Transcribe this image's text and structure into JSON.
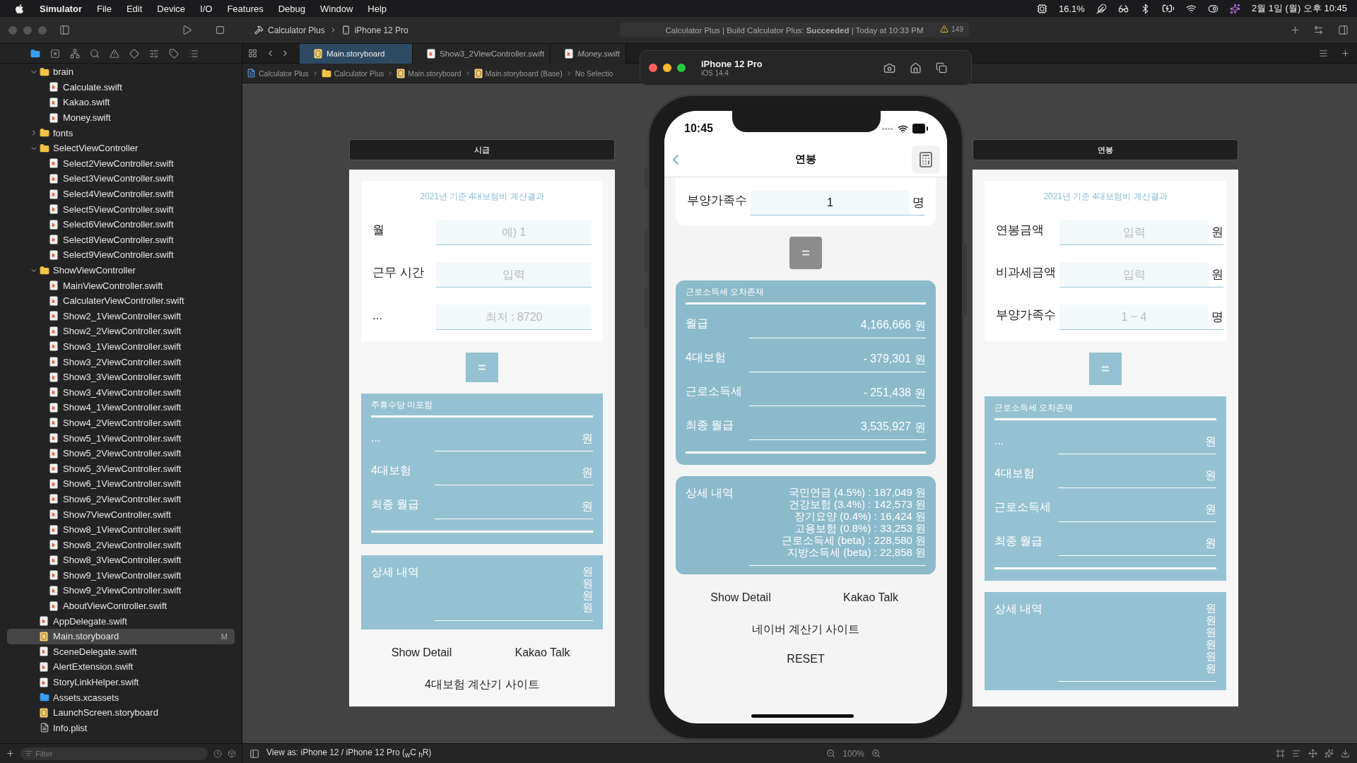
{
  "menu_bar": {
    "app": "Simulator",
    "menus": [
      "File",
      "Edit",
      "Device",
      "I/O",
      "Features",
      "Debug",
      "Window",
      "Help"
    ],
    "cpu": "16.1%",
    "clock": "2월 1일 (월) 오후 10:45"
  },
  "toolbar": {
    "scheme": "Calculator Plus",
    "destination": "iPhone 12 Pro",
    "activity": "Calculator Plus | Build Calculator Plus: **Succeeded** | Today at 10:33 PM",
    "warnings": "149"
  },
  "navigator": {
    "tree": [
      {
        "name": "brain",
        "kind": "folder",
        "expanded": true,
        "selected": false,
        "children": [
          {
            "name": "Calculate.swift",
            "kind": "swift",
            "selected": false
          },
          {
            "name": "Kakao.swift",
            "kind": "swift",
            "selected": false
          },
          {
            "name": "Money.swift",
            "kind": "swift",
            "selected": false
          }
        ]
      },
      {
        "name": "fonts",
        "kind": "folder",
        "expanded": false,
        "selected": false
      },
      {
        "name": "SelectViewController",
        "kind": "folder",
        "expanded": true,
        "selected": false,
        "children": [
          {
            "name": "Select2ViewController.swift",
            "kind": "swift",
            "selected": false
          },
          {
            "name": "Select3ViewController.swift",
            "kind": "swift",
            "selected": false
          },
          {
            "name": "Select4ViewController.swift",
            "kind": "swift",
            "selected": false
          },
          {
            "name": "Select5ViewController.swift",
            "kind": "swift",
            "selected": false
          },
          {
            "name": "Select6ViewController.swift",
            "kind": "swift",
            "selected": false
          },
          {
            "name": "Select8ViewController.swift",
            "kind": "swift",
            "selected": false
          },
          {
            "name": "Select9ViewController.swift",
            "kind": "swift",
            "selected": false
          }
        ]
      },
      {
        "name": "ShowViewController",
        "kind": "folder",
        "expanded": true,
        "selected": false,
        "children": [
          {
            "name": "MainViewController.swift",
            "kind": "swift",
            "selected": false
          },
          {
            "name": "CalculaterViewController.swift",
            "kind": "swift",
            "selected": false
          },
          {
            "name": "Show2_1ViewController.swift",
            "kind": "swift",
            "selected": false
          },
          {
            "name": "Show2_2ViewController.swift",
            "kind": "swift",
            "selected": false
          },
          {
            "name": "Show3_1ViewController.swift",
            "kind": "swift",
            "selected": false
          },
          {
            "name": "Show3_2ViewController.swift",
            "kind": "swift",
            "selected": false
          },
          {
            "name": "Show3_3ViewController.swift",
            "kind": "swift",
            "selected": false
          },
          {
            "name": "Show3_4ViewController.swift",
            "kind": "swift",
            "selected": false
          },
          {
            "name": "Show4_1ViewController.swift",
            "kind": "swift",
            "selected": false
          },
          {
            "name": "Show4_2ViewController.swift",
            "kind": "swift",
            "selected": false
          },
          {
            "name": "Show5_1ViewController.swift",
            "kind": "swift",
            "selected": false
          },
          {
            "name": "Show5_2ViewController.swift",
            "kind": "swift",
            "selected": false
          },
          {
            "name": "Show5_3ViewController.swift",
            "kind": "swift",
            "selected": false
          },
          {
            "name": "Show6_1ViewController.swift",
            "kind": "swift",
            "selected": false
          },
          {
            "name": "Show6_2ViewController.swift",
            "kind": "swift",
            "selected": false
          },
          {
            "name": "Show7ViewController.swift",
            "kind": "swift",
            "selected": false
          },
          {
            "name": "Show8_1ViewController.swift",
            "kind": "swift",
            "selected": false
          },
          {
            "name": "Show8_2ViewController.swift",
            "kind": "swift",
            "selected": false
          },
          {
            "name": "Show8_3ViewController.swift",
            "kind": "swift",
            "selected": false
          },
          {
            "name": "Show9_1ViewController.swift",
            "kind": "swift",
            "selected": false
          },
          {
            "name": "Show9_2ViewController.swift",
            "kind": "swift",
            "selected": false
          },
          {
            "name": "AboutViewController.swift",
            "kind": "swift",
            "selected": false
          }
        ]
      },
      {
        "name": "AppDelegate.swift",
        "kind": "swift",
        "selected": false
      },
      {
        "name": "Main.storyboard",
        "kind": "storyboard",
        "selected": true,
        "badge": "M"
      },
      {
        "name": "SceneDelegate.swift",
        "kind": "swift",
        "selected": false
      },
      {
        "name": "AlertExtension.swift",
        "kind": "swift",
        "selected": false
      },
      {
        "name": "StoryLinkHelper.swift",
        "kind": "swift",
        "selected": false
      },
      {
        "name": "Assets.xcassets",
        "kind": "assets",
        "selected": false
      },
      {
        "name": "LaunchScreen.storyboard",
        "kind": "storyboard",
        "selected": false
      },
      {
        "name": "Info.plist",
        "kind": "plist",
        "selected": false
      }
    ],
    "filter": {
      "placeholder": "Filter"
    }
  },
  "editor": {
    "tabs": [
      {
        "label": "Main.storyboard",
        "kind": "storyboard",
        "selected": true,
        "preview": false
      },
      {
        "label": "Show3_2ViewController.swift",
        "kind": "swift",
        "selected": false,
        "preview": false
      },
      {
        "label": "Money.swift",
        "kind": "swift",
        "selected": false,
        "preview": true
      }
    ],
    "jump_bar": [
      {
        "label": "Calculator Plus",
        "kind": "project"
      },
      {
        "label": "Calculator Plus",
        "kind": "folder"
      },
      {
        "label": "Main.storyboard",
        "kind": "storyboard"
      },
      {
        "label": "Main.storyboard (Base)",
        "kind": "storyboard"
      },
      {
        "label": "No Selectio",
        "kind": "none"
      }
    ],
    "scenes": [
      {
        "title": "시급",
        "header": "2021년 기준 4대보험비 계산결과",
        "inputs": [
          {
            "label": "월",
            "placeholder": "예) 1"
          },
          {
            "label": "근무 시간",
            "placeholder": "입력"
          },
          {
            "label": "...",
            "placeholder": "최저 : 8720"
          }
        ],
        "equals": {
          "label": "=",
          "dimmed": false
        },
        "result": {
          "note": "주휴수당 미포함",
          "rows": [
            {
              "label": "...",
              "unit": "원"
            },
            {
              "label": "4대보험",
              "unit": "원"
            },
            {
              "label": "최종 월급",
              "unit": "원"
            }
          ]
        },
        "detail": {
          "label": "상세 내역",
          "lines": [
            "원",
            "원",
            "원",
            "원"
          ]
        },
        "buttons": [
          "Show Detail",
          "Kakao Talk"
        ],
        "links": [
          "4대보험 계산기 사이트"
        ]
      },
      {
        "title": "연봉",
        "header": "2021년 기준 4대보험비 계산결과",
        "inputs": [
          {
            "label": "연봉금액",
            "placeholder": "입력",
            "unit": "원"
          },
          {
            "label": "비과세금액",
            "placeholder": "입력",
            "unit": "원"
          },
          {
            "label": "부양가족수",
            "placeholder": "1 ~ 4",
            "unit": "명"
          }
        ],
        "equals": {
          "label": "=",
          "dimmed": false
        },
        "result": {
          "note": "근로소득세 오차존재",
          "rows": [
            {
              "label": "...",
              "unit": "원"
            },
            {
              "label": "4대보험",
              "unit": "원"
            },
            {
              "label": "근로소득세",
              "unit": "원"
            },
            {
              "label": "최종 월급",
              "unit": "원"
            }
          ]
        },
        "detail": {
          "label": "상세 내역",
          "lines": [
            "원",
            "원",
            "원",
            "원",
            "원",
            "원"
          ]
        }
      }
    ],
    "bottom_bar": {
      "view_as": "View as: iPhone 12 / iPhone 12 Pro ($_{w}$C $_{h}$R)",
      "zoom": "100%"
    }
  },
  "simulator": {
    "title": "iPhone 12 Pro",
    "subtitle": "iOS 14.4",
    "phone": {
      "time": "10:45",
      "nav_title": "연봉",
      "inputs": [
        {
          "label": "부양가족수",
          "value": "1",
          "unit": "명"
        }
      ],
      "equals": {
        "label": "=",
        "dimmed": true
      },
      "result": {
        "note": "근로소득세 오차존재",
        "rows": [
          {
            "label": "월급",
            "value": "4,166,666",
            "unit": "원"
          },
          {
            "label": "4대보험",
            "value": "- 379,301",
            "unit": "원"
          },
          {
            "label": "근로소득세",
            "value": "- 251,438",
            "unit": "원"
          },
          {
            "label": "최종 월급",
            "value": "3,535,927",
            "unit": "원"
          }
        ]
      },
      "detail": {
        "label": "상세 내역",
        "lines": [
          "국민연금 (4.5%) : 187,049 원",
          "건강보험 (3.4%) : 142,573 원",
          "장기요양 (0.4%) : 16,424 원",
          "고용보험 (0.8%) : 33,253 원",
          "근로소득세 (beta) : 228,580 원",
          "지방소득세 (beta) : 22,858 원"
        ]
      },
      "buttons": [
        "Show Detail",
        "Kakao Talk"
      ],
      "links": [
        "네이버 계산기 사이트",
        "RESET"
      ]
    }
  }
}
